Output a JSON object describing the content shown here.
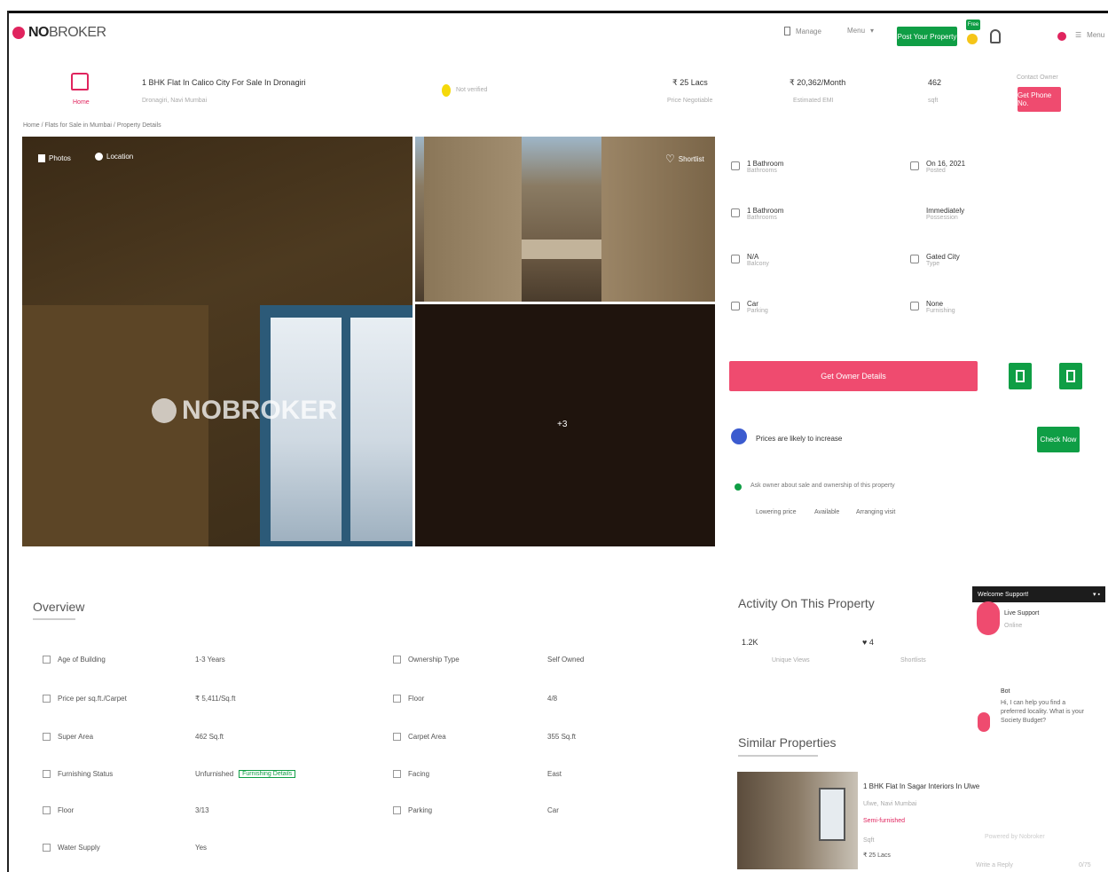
{
  "header": {
    "logo_text_bold": "NO",
    "logo_text_light": "BROKER",
    "nav_item_1": "Manage",
    "nav_item_2": "Menu",
    "post_property_label": "Post Your Property",
    "free_badge": "Free",
    "user_label": "",
    "menu_label": "Menu"
  },
  "listing": {
    "title": "1 BHK Flat In Calico City For Sale In Dronagiri",
    "subtitle": "Dronagiri, Navi Mumbai",
    "tag": "Not verified",
    "price": "₹ 25 Lacs",
    "price_sub": "Price Negotiable",
    "emi": "₹ 20,362/Month",
    "emi_sub": "Estimated EMI",
    "area": "462",
    "area_sub": "sqft",
    "contact_label": "Get Phone No.",
    "contact_hint": "Contact Owner",
    "breadcrumb": "Home / Flats for Sale in Mumbai / Property Details",
    "home_icon_label": "Home"
  },
  "gallery": {
    "photos_label": "Photos",
    "location_label": "Location",
    "shortlist_label": "Shortlist",
    "more_count": "+3",
    "watermark": "NOBROKER"
  },
  "specs": [
    {
      "value": "1 Bathroom",
      "label": "Bathrooms"
    },
    {
      "value": "On 16, 2021",
      "label": "Posted"
    },
    {
      "value": "1 Bathroom",
      "label": "Bathrooms"
    },
    {
      "value": "Immediately",
      "label": "Possession"
    },
    {
      "value": "N/A",
      "label": "Balcony"
    },
    {
      "value": "Gated City",
      "label": "Type"
    },
    {
      "value": "Car",
      "label": "Parking"
    },
    {
      "value": "None",
      "label": "Furnishing"
    }
  ],
  "actions": {
    "get_owner_label": "Get Owner Details",
    "loan_text": "Prices are likely to increase",
    "loan_button": "Check Now",
    "tip_text": "Ask owner about sale and ownership of this property",
    "tip_links": [
      "Lowering price",
      "Available",
      "Arranging visit"
    ]
  },
  "overview": {
    "title": "Overview",
    "rows": [
      {
        "label": "Age of Building",
        "value": "1-3 Years"
      },
      {
        "label": "Ownership Type",
        "value": "Self Owned"
      },
      {
        "label": "Price per sq.ft./Carpet",
        "value": "₹ 5,411/Sq.ft"
      },
      {
        "label": "Floor",
        "value": "4/8"
      },
      {
        "label": "Super Area",
        "value": "462 Sq.ft"
      },
      {
        "label": "Carpet Area",
        "value": "355 Sq.ft"
      },
      {
        "label": "Furnishing Status",
        "value": "Unfurnished"
      },
      {
        "label": "Facing",
        "value": "East"
      },
      {
        "label": "Floor",
        "value": "3/13"
      },
      {
        "label": "Parking",
        "value": "Car"
      },
      {
        "label": "Water Supply",
        "value": "Yes"
      }
    ],
    "furnishing_link": "Furnishing Details"
  },
  "activity": {
    "title": "Activity On This Property",
    "views": "1.2K",
    "views_label": "Unique Views",
    "shortlists": "4",
    "shortlists_label": "Shortlists"
  },
  "similar": {
    "title": "Similar Properties",
    "item_title": "1 BHK Flat In Sagar Interiors In Ulwe",
    "item_sub": "Ulwe, Navi Mumbai",
    "item_price": "₹ 25 Lacs",
    "item_area": "Sqft",
    "item_extra": "Semi-furnished"
  },
  "chat": {
    "header": "Welcome Support!",
    "agent": "Live Support",
    "agent_status": "Online",
    "bot_name": "Bot",
    "bot_message": "Hi, I can help you find a preferred locality. What is your Society Budget?",
    "footer_a": "Powered by Nobroker",
    "footer_b": "Write a Reply",
    "footer_c": "0/75"
  },
  "colors": {
    "brand": "#e0245e",
    "green": "#0f9e45",
    "pink": "#ef4b6f",
    "blue": "#3b5bcf"
  }
}
